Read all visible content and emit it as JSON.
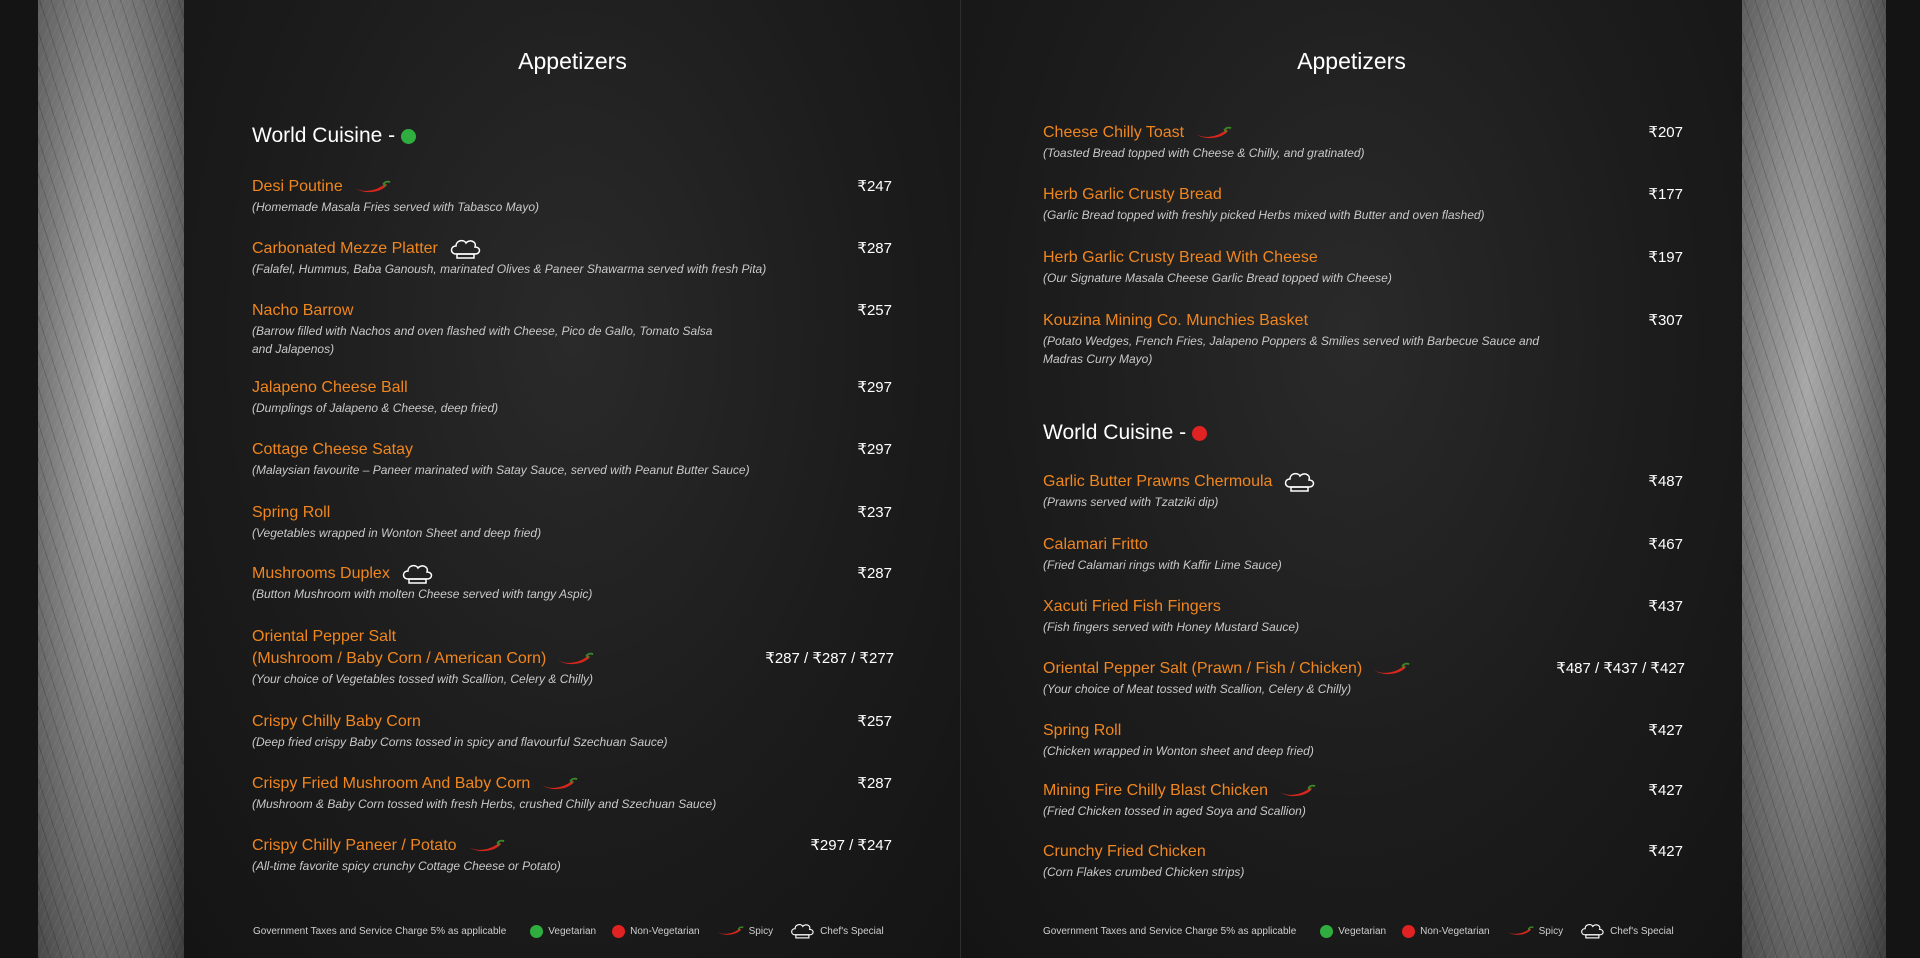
{
  "left_page": {
    "heading": "Appetizers",
    "section": "World Cuisine -",
    "items": [
      {
        "name": "Desi Poutine",
        "desc": "(Homemade Masala Fries served with Tabasco Mayo)",
        "price": "₹247"
      },
      {
        "name": "Carbonated Mezze Platter",
        "desc": "(Falafel, Hummus, Baba Ganoush, marinated Olives & Paneer Shawarma served with fresh Pita)",
        "price": "₹287"
      },
      {
        "name": "Nacho Barrow",
        "desc": "(Barrow filled with Nachos and oven flashed with Cheese, Pico de Gallo, Tomato Salsa",
        "desc2": "and Jalapenos)",
        "price": "₹257"
      },
      {
        "name": "Jalapeno Cheese Ball",
        "desc": "(Dumplings of Jalapeno & Cheese, deep fried)",
        "price": "₹297"
      },
      {
        "name": "Cottage Cheese Satay",
        "desc": "(Malaysian favourite – Paneer marinated with Satay Sauce, served with Peanut Butter Sauce)",
        "price": "₹297"
      },
      {
        "name": "Spring Roll",
        "desc": "(Vegetables wrapped in Wonton Sheet and deep fried)",
        "price": "₹237"
      },
      {
        "name": "Mushrooms Duplex",
        "desc": "(Button Mushroom with molten Cheese served with tangy Aspic)",
        "price": "₹287"
      },
      {
        "name": "Oriental Pepper Salt",
        "name2": "(Mushroom / Baby Corn / American Corn)",
        "desc": "(Your choice of Vegetables tossed with Scallion, Celery & Chilly)",
        "price": "₹287 / ₹287 / ₹277"
      },
      {
        "name": "Crispy Chilly Baby Corn",
        "desc": "(Deep fried crispy Baby Corns tossed in spicy and flavourful Szechuan Sauce)",
        "price": "₹257"
      },
      {
        "name": "Crispy Fried Mushroom And Baby Corn",
        "desc": "(Mushroom & Baby Corn tossed with fresh Herbs, crushed Chilly and Szechuan Sauce)",
        "price": "₹287"
      },
      {
        "name": "Crispy Chilly Paneer / Potato",
        "desc": "(All-time favorite spicy crunchy Cottage Cheese or Potato)",
        "price": "₹297 / ₹247"
      }
    ]
  },
  "right_page": {
    "heading": "Appetizers",
    "section": "World Cuisine -",
    "items_top": [
      {
        "name": "Cheese Chilly Toast",
        "desc": "(Toasted Bread topped with Cheese & Chilly, and gratinated)",
        "price": "₹207"
      },
      {
        "name": "Herb Garlic Crusty Bread",
        "desc": "(Garlic Bread topped with freshly picked Herbs mixed with Butter and oven flashed)",
        "price": "₹177"
      },
      {
        "name": "Herb Garlic Crusty Bread With Cheese",
        "desc": "(Our Signature Masala Cheese Garlic Bread topped with Cheese)",
        "price": "₹197"
      },
      {
        "name": "Kouzina Mining Co. Munchies Basket",
        "desc": "(Potato Wedges, French Fries, Jalapeno Poppers & Smilies served with Barbecue Sauce and",
        "desc2": "Madras Curry Mayo)",
        "price": "₹307"
      }
    ],
    "items": [
      {
        "name": "Garlic Butter Prawns Chermoula",
        "desc": "(Prawns served with Tzatziki dip)",
        "price": "₹487"
      },
      {
        "name": "Calamari Fritto",
        "desc": "(Fried Calamari rings with Kaffir Lime Sauce)",
        "price": "₹467"
      },
      {
        "name": "Xacuti Fried Fish Fingers",
        "desc": "(Fish fingers served with Honey Mustard Sauce)",
        "price": "₹437"
      },
      {
        "name": "Oriental Pepper Salt (Prawn / Fish / Chicken)",
        "desc": "(Your choice of Meat tossed with Scallion, Celery & Chilly)",
        "price": "₹487 / ₹437 / ₹427"
      },
      {
        "name": "Spring Roll",
        "desc": "(Chicken wrapped in Wonton sheet and deep fried)",
        "price": "₹427"
      },
      {
        "name": "Mining Fire Chilly Blast Chicken",
        "desc": "(Fried Chicken tossed in aged Soya and Scallion)",
        "price": "₹427"
      },
      {
        "name": "Crunchy Fried Chicken",
        "desc": "(Corn Flakes crumbed Chicken strips)",
        "price": "₹427"
      }
    ]
  },
  "footer": {
    "tax_note": "Government Taxes and Service Charge 5% as applicable",
    "veg": "Vegetarian",
    "nonveg": "Non-Vegetarian",
    "spicy": "Spicy",
    "chef": "Chef's Special"
  },
  "icons": {
    "spicy": "chili-pepper-icon",
    "chef": "chef-hat-icon",
    "veg": "green-dot-icon",
    "nonveg": "red-dot-icon"
  },
  "colors": {
    "item_name": "#f0861f",
    "veg": "#2fae3f",
    "nonveg": "#e02222",
    "chili": "#d9261c"
  }
}
